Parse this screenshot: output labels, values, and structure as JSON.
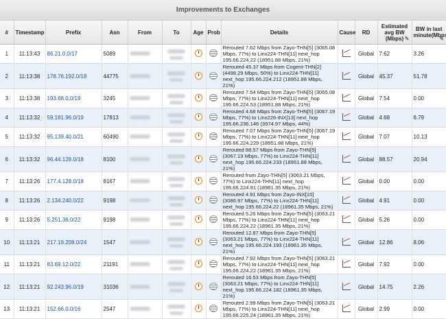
{
  "panel": {
    "title": "Improvements to Exchanges"
  },
  "columns": [
    "#",
    "Timestamp",
    "Prefix",
    "Asn",
    "From",
    "To",
    "Age",
    "Prob",
    "Details",
    "Cause",
    "RD",
    "Estimated avg BW (Mbps)",
    "BW in last minute(Mbps)"
  ],
  "rows": [
    {
      "num": "1",
      "ts": "11:13:43",
      "prefix": "86.21.0.0/17",
      "asn": "5089",
      "details": "Rerouted 7.62 Mbps from Zayo-THN[5] (3065.08 Mbps, 77%) to Linx224-THN[11] next_hop 195.66.224.22 (18951.88 Mbps, 21%)",
      "rd": "Global",
      "avg": "7.62",
      "last": "3.26"
    },
    {
      "num": "2",
      "ts": "11:13:38",
      "prefix": "178.76.192.0/18",
      "asn": "44775",
      "details": "Rerouted 45.37 Mbps from Cogent-THN[2] (4498.29 Mbps, 50%) to Linx224-THN[11] next_hop 195.66.224.212 (18951.88 Mbps, 21%)",
      "rd": "Global",
      "avg": "45.37",
      "last": "51.78"
    },
    {
      "num": "3",
      "ts": "11:13:38",
      "prefix": "193.68.0.0/19",
      "asn": "3245",
      "details": "Rerouted 7.54 Mbps from Zayo-THN[5] (3065.08 Mbps, 77%) to Linx224-THN[11] next_hop 195.66.224.53 (18951.88 Mbps, 21%)",
      "rd": "Global",
      "avg": "7.54",
      "last": "0.00"
    },
    {
      "num": "4",
      "ts": "11:13:32",
      "prefix": "59.181.96.0/19",
      "asn": "17813",
      "details": "Rerouted 4.68 Mbps from Zayo-THN[5] (3067.19 Mbps, 77%) to Linx226-INX[13] next_hop 195.66.236.146 (3974.97 Mbps, 44%)",
      "rd": "Global",
      "avg": "4.68",
      "last": "6.79"
    },
    {
      "num": "5",
      "ts": "11:13:32",
      "prefix": "95.139.40.0/21",
      "asn": "60490",
      "details": "Rerouted 7.07 Mbps from Zayo-THN[5] (3067.19 Mbps, 77%) to Linx224-THN[11] next_hop 195.66.224.229 (18951.88 Mbps, 21%)",
      "rd": "Global",
      "avg": "7.07",
      "last": "10.13"
    },
    {
      "num": "6",
      "ts": "11:13:32",
      "prefix": "96.44.128.0/18",
      "asn": "8100",
      "details": "Rerouted 88.57 Mbps from Zayo-THN[5] (3067.19 Mbps, 77%) to Linx224-THN[11] next_hop 195.66.224.233 (18951.88 Mbps, 21%)",
      "rd": "Global",
      "avg": "88.57",
      "last": "20.94"
    },
    {
      "num": "7",
      "ts": "11:13:26",
      "prefix": "177.4.128.0/18",
      "asn": "8167",
      "details": "Rerouted from Zayo-THN[5] (3063.21 Mbps, 77%) to Linx224-THN[11] next_hop 195.66.224.91 (18961.35 Mbps, 21%)",
      "rd": "Global",
      "avg": "0.00",
      "last": "0.00"
    },
    {
      "num": "8",
      "ts": "11:13:26",
      "prefix": "2.134.240.0/22",
      "asn": "9198",
      "details": "Rerouted 4.91 Mbps from Zayo-INX[10] (3086.97 Mbps, 77%) to Linx224-THN[11] next_hop 195.66.224.22 (18961.35 Mbps, 21%)",
      "rd": "Global",
      "avg": "4.91",
      "last": "0.00"
    },
    {
      "num": "9",
      "ts": "11:13:26",
      "prefix": "5.251.36.0/22",
      "asn": "9198",
      "details": "Rerouted 5.26 Mbps from Zayo-THN[5] (3063.21 Mbps, 77%) to Linx224-THN[11] next_hop 195.66.224.22 (18961.35 Mbps, 21%)",
      "rd": "Global",
      "avg": "5.26",
      "last": "0.00"
    },
    {
      "num": "10",
      "ts": "11:13:21",
      "prefix": "217.19.208.0/24",
      "asn": "1547",
      "details": "Rerouted 12.87 Mbps from Zayo-THN[5] (3063.21 Mbps, 77%) to Linx224-THN[11] next_hop 195.66.224.193 (18961.35 Mbps, 21%)",
      "rd": "Global",
      "avg": "12.86",
      "last": "8.06"
    },
    {
      "num": "11",
      "ts": "11:13:21",
      "prefix": "83.69.12.0/22",
      "asn": "21191",
      "details": "Rerouted 7.92 Mbps from Zayo-THN[5] (3063.21 Mbps, 77%) to Linx224-THN[11] next_hop 195.66.224.22 (18961.35 Mbps, 21%)",
      "rd": "Global",
      "avg": "7.92",
      "last": "0.00"
    },
    {
      "num": "12",
      "ts": "11:13:21",
      "prefix": "92.243.96.0/19",
      "asn": "31036",
      "details": "Rerouted 16.53 Mbps from Zayo-THN[5] (3063.21 Mbps, 77%) to Linx224-THN[11] next_hop 195.66.224.182 (18961.35 Mbps, 21%)",
      "rd": "Global",
      "avg": "14.75",
      "last": "2.26"
    },
    {
      "num": "13",
      "ts": "11:13:21",
      "prefix": "152.66.0.0/16",
      "asn": "2547",
      "details": "Rerouted 2.99 Mbps from Zayo-THN[5] (3063.21 Mbps, 77%) to Linx224-THN[11] next_hop 195.66.225.24 (18961.35 Mbps, 21%)",
      "rd": "Global",
      "avg": "2.99",
      "last": "0.00"
    }
  ],
  "icons": {
    "age": "clock-icon",
    "prob": "probe-icon",
    "cause": "line-chart-icon",
    "edit": "pencil-icon"
  }
}
